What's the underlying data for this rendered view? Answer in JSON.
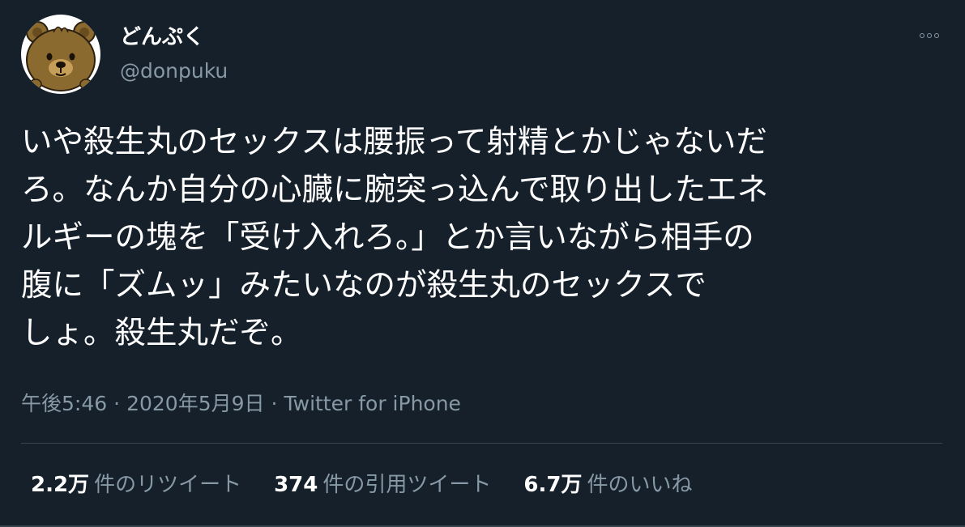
{
  "author": {
    "display_name": "どんぷく",
    "handle": "@donpuku",
    "avatar_icon": "bear-avatar-icon"
  },
  "more_icon": "more-options-icon",
  "tweet": {
    "lines": [
      "いや殺生丸のセックスは腰振って射精とかじゃないだ",
      "ろ。なんか自分の心臓に腕突っ込んで取り出したエネ",
      "ルギーの塊を「受け入れろ。」とか言いながら相手の",
      "腹に「ズムッ」みたいなのが殺生丸のセックスで",
      "しょ。殺生丸だぞ。"
    ]
  },
  "meta": {
    "time": "午後5:46",
    "separator": "·",
    "date": "2020年5月9日",
    "source": "Twitter for iPhone"
  },
  "stats": {
    "retweets": {
      "count": "2.2万",
      "label": "件のリツイート"
    },
    "quotes": {
      "count": "374",
      "label": "件の引用ツイート"
    },
    "likes": {
      "count": "6.7万",
      "label": "件のいいね"
    }
  },
  "colors": {
    "background": "#15202b",
    "text": "#ffffff",
    "secondary": "#8899a6",
    "divider": "#38444d"
  }
}
